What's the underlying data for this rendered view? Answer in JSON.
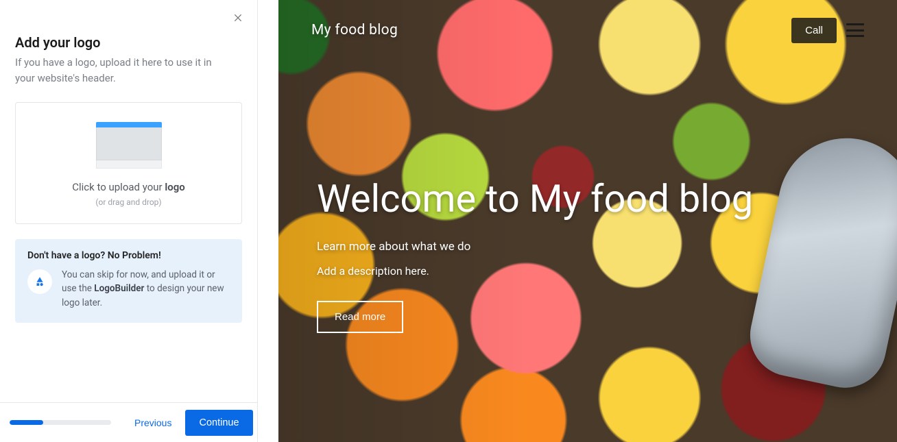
{
  "panel": {
    "title": "Add your logo",
    "subtitle": "If you have a logo, upload it here to use it in your website's header.",
    "upload": {
      "text_prefix": "Click to upload your ",
      "text_bold": "logo",
      "drag_hint": "(or drag and drop)"
    },
    "tip": {
      "title": "Don't have a logo? No Problem!",
      "body_pre": "You can skip for now, and upload it or use the ",
      "link": "LogoBuilder",
      "body_post": " to design your new logo later."
    }
  },
  "footer": {
    "progress_percent": 33,
    "previous": "Previous",
    "continue": "Continue"
  },
  "preview": {
    "site_title": "My food blog",
    "call_label": "Call",
    "hero_heading": "Welcome to My food blog",
    "hero_line1": "Learn more about what we do",
    "hero_line2": "Add a description here.",
    "read_more": "Read more"
  }
}
